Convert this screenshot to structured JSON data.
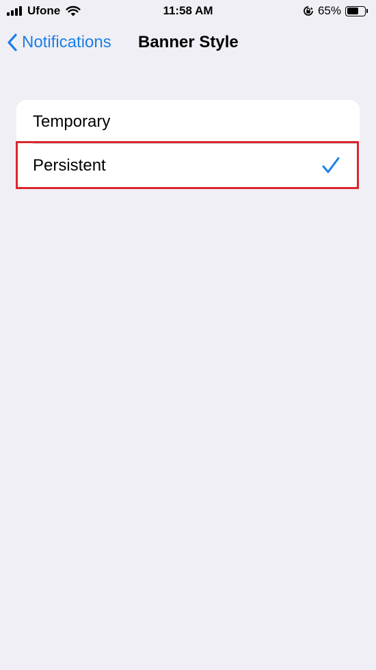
{
  "status_bar": {
    "carrier": "Ufone",
    "time": "11:58 AM",
    "battery_percent": "65%",
    "battery_level": 0.65
  },
  "nav": {
    "back_label": "Notifications",
    "title": "Banner Style"
  },
  "options": [
    {
      "label": "Temporary",
      "selected": false
    },
    {
      "label": "Persistent",
      "selected": true
    }
  ],
  "colors": {
    "accent": "#1a7fe6",
    "highlight": "#d9262e",
    "background": "#f0eff5"
  }
}
